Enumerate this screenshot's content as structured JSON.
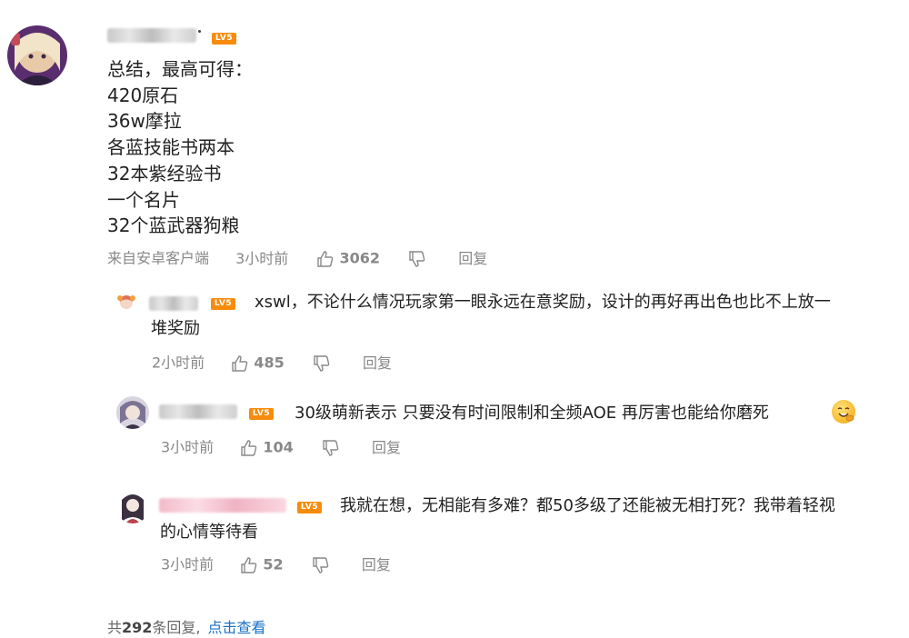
{
  "comment": {
    "level_badge": "LV5",
    "lines": [
      "总结，最高可得：",
      "420原石",
      "36w摩拉",
      "各蓝技能书两本",
      "32本紫经验书",
      "一个名片",
      "32个蓝武器狗粮"
    ],
    "source": "来自安卓客户端",
    "time": "3小时前",
    "likes": "3062",
    "reply_label": "回复"
  },
  "replies": [
    {
      "level_badge": "LV5",
      "text": "xswl，不论什么情况玩家第一眼永远在意奖励，设计的再好再出色也比不上放一",
      "text_cont": "堆奖励",
      "time": "2小时前",
      "likes": "485",
      "reply_label": "回复"
    },
    {
      "level_badge": "LV5",
      "text": "30级萌新表示 只要没有时间限制和全频AOE  再厉害也能给你磨死",
      "time": "3小时前",
      "likes": "104",
      "reply_label": "回复"
    },
    {
      "level_badge": "LV5",
      "text": "我就在想，无相能有多难？都50多级了还能被无相打死？我带着轻视",
      "text_cont": "的心情等待看",
      "time": "3小时前",
      "likes": "52",
      "reply_label": "回复"
    }
  ],
  "footer": {
    "prefix": "共",
    "count": "292",
    "suffix": "条回复,",
    "link": "点击查看"
  },
  "colors": {
    "level_badge": "#f78c0c",
    "link": "#1a73c8",
    "meta": "#888888"
  },
  "icons": [
    "thumb-up-icon",
    "thumb-down-icon",
    "grin-emoji-icon"
  ]
}
